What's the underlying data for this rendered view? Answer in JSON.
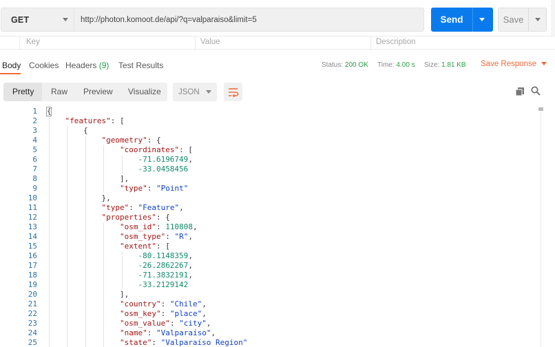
{
  "request": {
    "method": "GET",
    "url": "http://photon.komoot.de/api/?q=valparaiso&limit=5",
    "send_label": "Send",
    "save_label": "Save"
  },
  "params": {
    "columns": [
      "Key",
      "Value",
      "Description"
    ]
  },
  "response_tabs": {
    "body": "Body",
    "cookies": "Cookies",
    "headers_label": "Headers",
    "headers_count": "(9)",
    "test_results": "Test Results"
  },
  "status": {
    "status_label": "Status:",
    "status_value": "200 OK",
    "time_label": "Time:",
    "time_value": "4.00 s",
    "size_label": "Size:",
    "size_value": "1.81 KB",
    "save_response": "Save Response"
  },
  "viewer": {
    "modes": [
      "Pretty",
      "Raw",
      "Preview",
      "Visualize"
    ],
    "active_mode": "Pretty",
    "format": "JSON",
    "icons": [
      "wrap-lines-icon",
      "copy-icon",
      "search-icon"
    ]
  },
  "colors": {
    "accent_blue": "#097bed",
    "accent_orange": "#f26b3a",
    "status_green": "#2a9d47",
    "json_key": "#a31515",
    "json_string": "#0d3fc4",
    "json_number": "#0e8a6b",
    "line_number": "#2d6fa8"
  },
  "code_lines": [
    {
      "n": "1",
      "parts": [
        [
          "p",
          "{"
        ]
      ]
    },
    {
      "n": "2",
      "parts": [
        [
          "p",
          "    "
        ],
        [
          "k",
          "\"features\""
        ],
        [
          "p",
          ": ["
        ]
      ]
    },
    {
      "n": "3",
      "parts": [
        [
          "p",
          "        {"
        ]
      ]
    },
    {
      "n": "4",
      "parts": [
        [
          "p",
          "            "
        ],
        [
          "k",
          "\"geometry\""
        ],
        [
          "p",
          ": {"
        ]
      ]
    },
    {
      "n": "5",
      "parts": [
        [
          "p",
          "                "
        ],
        [
          "k",
          "\"coordinates\""
        ],
        [
          "p",
          ": ["
        ]
      ]
    },
    {
      "n": "6",
      "parts": [
        [
          "p",
          "                    "
        ],
        [
          "n",
          "-71.6196749"
        ],
        [
          "p",
          ","
        ]
      ]
    },
    {
      "n": "7",
      "parts": [
        [
          "p",
          "                    "
        ],
        [
          "n",
          "-33.0458456"
        ]
      ]
    },
    {
      "n": "8",
      "parts": [
        [
          "p",
          "                ],"
        ]
      ]
    },
    {
      "n": "9",
      "parts": [
        [
          "p",
          "                "
        ],
        [
          "k",
          "\"type\""
        ],
        [
          "p",
          ": "
        ],
        [
          "s",
          "\"Point\""
        ]
      ]
    },
    {
      "n": "10",
      "parts": [
        [
          "p",
          "            },"
        ]
      ]
    },
    {
      "n": "11",
      "parts": [
        [
          "p",
          "            "
        ],
        [
          "k",
          "\"type\""
        ],
        [
          "p",
          ": "
        ],
        [
          "s",
          "\"Feature\""
        ],
        [
          "p",
          ","
        ]
      ]
    },
    {
      "n": "12",
      "parts": [
        [
          "p",
          "            "
        ],
        [
          "k",
          "\"properties\""
        ],
        [
          "p",
          ": {"
        ]
      ]
    },
    {
      "n": "13",
      "parts": [
        [
          "p",
          "                "
        ],
        [
          "k",
          "\"osm_id\""
        ],
        [
          "p",
          ": "
        ],
        [
          "n",
          "110808"
        ],
        [
          "p",
          ","
        ]
      ]
    },
    {
      "n": "14",
      "parts": [
        [
          "p",
          "                "
        ],
        [
          "k",
          "\"osm_type\""
        ],
        [
          "p",
          ": "
        ],
        [
          "s",
          "\"R\""
        ],
        [
          "p",
          ","
        ]
      ]
    },
    {
      "n": "15",
      "parts": [
        [
          "p",
          "                "
        ],
        [
          "k",
          "\"extent\""
        ],
        [
          "p",
          ": ["
        ]
      ]
    },
    {
      "n": "16",
      "parts": [
        [
          "p",
          "                    "
        ],
        [
          "n",
          "-80.1148359"
        ],
        [
          "p",
          ","
        ]
      ]
    },
    {
      "n": "17",
      "parts": [
        [
          "p",
          "                    "
        ],
        [
          "n",
          "-26.2862267"
        ],
        [
          "p",
          ","
        ]
      ]
    },
    {
      "n": "18",
      "parts": [
        [
          "p",
          "                    "
        ],
        [
          "n",
          "-71.3832191"
        ],
        [
          "p",
          ","
        ]
      ]
    },
    {
      "n": "19",
      "parts": [
        [
          "p",
          "                    "
        ],
        [
          "n",
          "-33.2129142"
        ]
      ]
    },
    {
      "n": "20",
      "parts": [
        [
          "p",
          "                ],"
        ]
      ]
    },
    {
      "n": "21",
      "parts": [
        [
          "p",
          "                "
        ],
        [
          "k",
          "\"country\""
        ],
        [
          "p",
          ": "
        ],
        [
          "s",
          "\"Chile\""
        ],
        [
          "p",
          ","
        ]
      ]
    },
    {
      "n": "22",
      "parts": [
        [
          "p",
          "                "
        ],
        [
          "k",
          "\"osm_key\""
        ],
        [
          "p",
          ": "
        ],
        [
          "s",
          "\"place\""
        ],
        [
          "p",
          ","
        ]
      ]
    },
    {
      "n": "23",
      "parts": [
        [
          "p",
          "                "
        ],
        [
          "k",
          "\"osm_value\""
        ],
        [
          "p",
          ": "
        ],
        [
          "s",
          "\"city\""
        ],
        [
          "p",
          ","
        ]
      ]
    },
    {
      "n": "24",
      "parts": [
        [
          "p",
          "                "
        ],
        [
          "k",
          "\"name\""
        ],
        [
          "p",
          ": "
        ],
        [
          "s",
          "\"Valparaíso\""
        ],
        [
          "p",
          ","
        ]
      ]
    },
    {
      "n": "25",
      "parts": [
        [
          "p",
          "                "
        ],
        [
          "k",
          "\"state\""
        ],
        [
          "p",
          ": "
        ],
        [
          "s",
          "\"Valparaíso Region\""
        ]
      ]
    }
  ]
}
